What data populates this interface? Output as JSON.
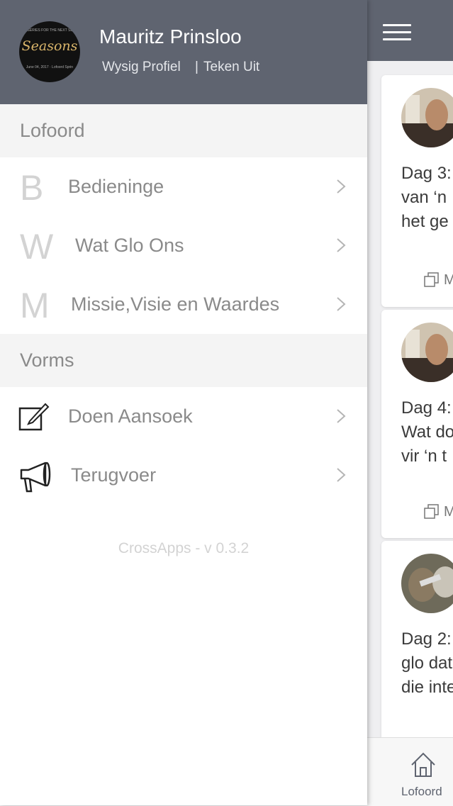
{
  "drawer": {
    "user_name": "Mauritz Prinsloo",
    "edit_profile": "Wysig Profiel",
    "separator": "|",
    "logout": "Teken Uit",
    "avatar": {
      "title": "Seasons",
      "line_top": "THE SERIES FOR THE NEXT SEVEN",
      "line_bottom": "June 04, 2017 · Lofoord Sprin"
    },
    "sections": [
      {
        "title": "Lofoord",
        "items": [
          {
            "letter": "B",
            "label": "Bedieninge"
          },
          {
            "letter": "W",
            "label": "Wat Glo Ons"
          },
          {
            "letter": "M",
            "label": "Missie,Visie en Waardes"
          }
        ]
      },
      {
        "title": "Vorms",
        "items": [
          {
            "icon": "edit-icon",
            "label": "Doen Aansoek"
          },
          {
            "icon": "megaphone-icon",
            "label": "Terugvoer"
          }
        ]
      }
    ],
    "version": "CrossApps - v 0.3.2"
  },
  "background": {
    "cards": [
      {
        "lines": [
          "Dag 3:",
          "van ‘n",
          "het ge"
        ],
        "action": "M"
      },
      {
        "lines": [
          "Dag 4:",
          "Wat do",
          "vir ‘n t"
        ],
        "action": "M"
      },
      {
        "lines": [
          "Dag 2:",
          "glo dat",
          "die inte"
        ],
        "action": ""
      }
    ],
    "tab_label": "Lofoord"
  },
  "colors": {
    "header": "#5f6470",
    "section_bg": "#f4f4f4",
    "text_muted": "#8a8a8a",
    "letter": "#d3d3d3"
  }
}
